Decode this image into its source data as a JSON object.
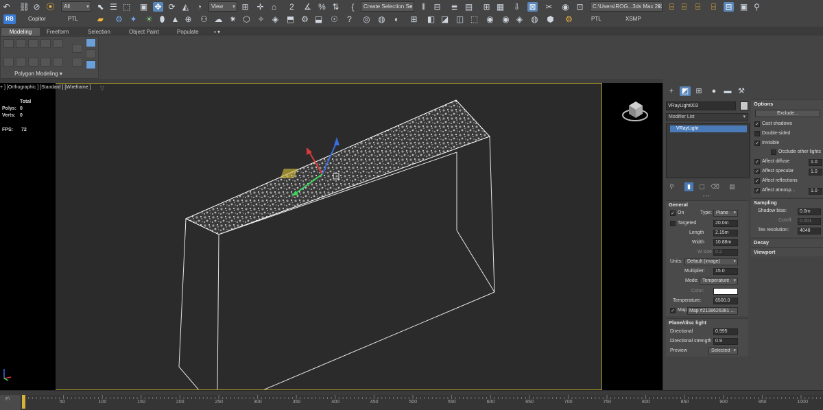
{
  "toolbar": {
    "selection_filter": "All",
    "ref_coord": "View",
    "named_selection": "Create Selection Se",
    "project_path": "C:\\Users\\ROG...3ds Max 2024",
    "snap_value": "2",
    "icons": [
      "undo-icon",
      "redo-icon",
      "link-icon",
      "unlink-icon",
      "bind-spacewarp-icon",
      "select-icon",
      "select-by-name-icon",
      "region-select-icon",
      "window-crossing-icon",
      "move-icon",
      "rotate-icon",
      "scale-icon",
      "placement-icon",
      "snap-icon",
      "angle-snap-icon",
      "percent-snap-icon",
      "spinner-snap-icon",
      "mirror-icon",
      "align-icon",
      "layer-icon",
      "graphite-icon",
      "curve-editor-icon",
      "schematic-icon",
      "material-editor-icon",
      "render-setup-icon",
      "render-frame-icon",
      "render-icon"
    ]
  },
  "row2": {
    "badge": "RB",
    "tabs": [
      "Copitor",
      "PTL",
      "PTL",
      "XSMP"
    ]
  },
  "ribbon": {
    "tabs": [
      "Modeling",
      "Freeform",
      "Selection",
      "Object Paint",
      "Populate"
    ],
    "active_tab": "Modeling",
    "panel_label": "Polygon Modeling ▾"
  },
  "viewport": {
    "label": "+ ] [Orthographic ] [Standard ] [Wireframe ]",
    "stats": {
      "header": "Total",
      "polys_label": "Polys:",
      "polys_value": "0",
      "verts_label": "Verts:",
      "verts_value": "0",
      "fps_label": "FPS:",
      "fps_value": "72"
    },
    "colors": {
      "border": "#a8992b",
      "bg": "#2b2b2b",
      "wire": "#e6e6e6"
    }
  },
  "command_panel": {
    "object_name": "VRayLight003",
    "modifier_list": "Modifier List",
    "stack_item": "VRayLight",
    "options": {
      "title": "Options",
      "exclude_button": "Exclude...",
      "cast_shadows": "Cast shadows",
      "double_sided": "Double-sided",
      "invisible": "Invisible",
      "occlude": "Occlude other lights",
      "affect_diffuse": "Affect diffuse",
      "affect_diffuse_value": "1.0",
      "affect_specular": "Affect specular",
      "affect_specular_value": "1.0",
      "affect_reflections": "Affect reflections",
      "affect_atmosp": "Affect atmosp...",
      "affect_atmosp_value": "1.0"
    },
    "sampling": {
      "title": "Sampling",
      "shadow_bias_label": "Shadow bias:",
      "shadow_bias_value": "0.0m",
      "cutoff_label": "Cutoff:",
      "cutoff_value": "0.001",
      "tex_res_label": "Tex resolution:",
      "tex_res_value": "4048"
    },
    "decay_title": "Decay",
    "viewport_title": "Viewport",
    "general": {
      "title": "General",
      "on_label": "On",
      "type_label": "Type:",
      "type_value": "Plane",
      "targeted_label": "Targeted",
      "targeted_value": "20.0m",
      "length_label": "Length",
      "length_value": "2.15m",
      "width_label": "Width",
      "width_value": "10.88m",
      "wsize_label": "W size",
      "wsize_value": "0.2",
      "units_label": "Units:",
      "units_value": "Default (image)",
      "multiplier_label": "Multiplier:",
      "multiplier_value": "15.0",
      "mode_label": "Mode:",
      "mode_value": "Temperature",
      "color_label": "Color:",
      "temperature_label": "Temperature:",
      "temperature_value": "6500.0",
      "map_label": "Map",
      "map_value": "Map #2138626381 ..."
    },
    "plane_disc": {
      "title": "Plane/disc light",
      "directional_label": "Directional",
      "directional_value": "0.995",
      "dir_strength_label": "Directional strength",
      "dir_strength_value": "0.9",
      "preview_label": "Preview",
      "preview_value": "Selected"
    }
  },
  "timeline": {
    "corner": "F\\",
    "ticks": [
      "50",
      "100",
      "150",
      "200",
      "250",
      "300",
      "350",
      "400",
      "450",
      "500",
      "550",
      "600",
      "650",
      "700",
      "750",
      "800",
      "850",
      "900",
      "950",
      "1000"
    ],
    "slider_frame": "0"
  }
}
